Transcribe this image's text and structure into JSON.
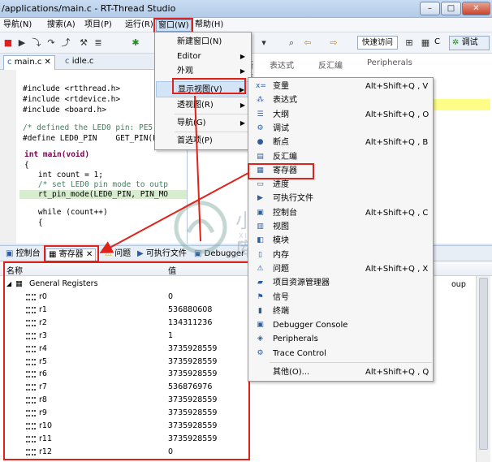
{
  "window": {
    "title": "/applications/main.c - RT-Thread Studio",
    "minimize": "–",
    "maximize": "□",
    "close": "✕"
  },
  "menubar": {
    "items": [
      "导航(N)",
      "搜索(A)",
      "项目(P)",
      "运行(R)",
      "窗口(W)",
      "帮助(H)"
    ]
  },
  "toolbar": {
    "quick_access": "快速访问",
    "c_persp": "C",
    "debug_persp": "调试"
  },
  "editor": {
    "tabs": [
      "main.c",
      "idle.c"
    ],
    "lines": [
      "#include <rtthread.h>",
      "#include <rtdevice.h>",
      "#include <board.h>",
      "/* defined the LED0 pin: PE5",
      "#define LED0_PIN    GET_PIN(E",
      "int main(void)",
      "{",
      "    int count = 1;",
      "    /* set LED0 pin mode to outp",
      "    rt_pin_mode(LED0_PIN, PIN_MO",
      "    while (count++)",
      "    {"
    ]
  },
  "right_tabs": [
    "断点",
    "表达式",
    "反汇编",
    "Peripherals"
  ],
  "bottom_tabs": [
    "控制台",
    "寄存器",
    "问题",
    "可执行文件",
    "Debugger C"
  ],
  "registers": {
    "col_name": "名称",
    "col_value": "值",
    "col_group": "oup",
    "group": "General Registers",
    "rows": [
      {
        "name": "r0",
        "value": "0"
      },
      {
        "name": "r1",
        "value": "536880608"
      },
      {
        "name": "r2",
        "value": "134311236"
      },
      {
        "name": "r3",
        "value": "1"
      },
      {
        "name": "r4",
        "value": "3735928559"
      },
      {
        "name": "r5",
        "value": "3735928559"
      },
      {
        "name": "r6",
        "value": "3735928559"
      },
      {
        "name": "r7",
        "value": "536876976"
      },
      {
        "name": "r8",
        "value": "3735928559"
      },
      {
        "name": "r9",
        "value": "3735928559"
      },
      {
        "name": "r10",
        "value": "3735928559"
      },
      {
        "name": "r11",
        "value": "3735928559"
      },
      {
        "name": "r12",
        "value": "0"
      }
    ]
  },
  "window_menu": {
    "items": [
      "新建窗口(N)",
      "Editor",
      "外观",
      "显示视图(V)",
      "透视图(R)",
      "导航(G)",
      "首选项(P)"
    ]
  },
  "show_view_menu": {
    "items": [
      {
        "label": "变量",
        "shortcut": "Alt+Shift+Q , V",
        "icon": "x="
      },
      {
        "label": "表达式",
        "shortcut": "",
        "icon": "⁂"
      },
      {
        "label": "大纲",
        "shortcut": "Alt+Shift+Q , O",
        "icon": "☰"
      },
      {
        "label": "调试",
        "shortcut": "",
        "icon": "⚙"
      },
      {
        "label": "断点",
        "shortcut": "Alt+Shift+Q , B",
        "icon": "●"
      },
      {
        "label": "反汇编",
        "shortcut": "",
        "icon": "▤"
      },
      {
        "label": "寄存器",
        "shortcut": "",
        "icon": "▦"
      },
      {
        "label": "进度",
        "shortcut": "",
        "icon": "▭"
      },
      {
        "label": "可执行文件",
        "shortcut": "",
        "icon": "▶"
      },
      {
        "label": "控制台",
        "shortcut": "Alt+Shift+Q , C",
        "icon": "▣"
      },
      {
        "label": "视图",
        "shortcut": "",
        "icon": "▥"
      },
      {
        "label": "模块",
        "shortcut": "",
        "icon": "◧"
      },
      {
        "label": "内存",
        "shortcut": "",
        "icon": "▯"
      },
      {
        "label": "问题",
        "shortcut": "Alt+Shift+Q , X",
        "icon": "⚠"
      },
      {
        "label": "项目资源管理器",
        "shortcut": "",
        "icon": "▰"
      },
      {
        "label": "信号",
        "shortcut": "",
        "icon": "⚑"
      },
      {
        "label": "终端",
        "shortcut": "",
        "icon": "▮"
      },
      {
        "label": "Debugger Console",
        "shortcut": "",
        "icon": "▣"
      },
      {
        "label": "Peripherals",
        "shortcut": "",
        "icon": "◈"
      },
      {
        "label": "Trace Control",
        "shortcut": "",
        "icon": "⚙"
      },
      {
        "label": "其他(O)...",
        "shortcut": "Alt+Shift+Q , Q",
        "icon": ""
      }
    ]
  },
  "watermark": {
    "text": "小牛知识库",
    "sub": "XIAO NIU ZHI SHI KU"
  },
  "colors": {
    "highlight_red": "#e0221a",
    "menu_highlight": "#d3e4f7"
  }
}
